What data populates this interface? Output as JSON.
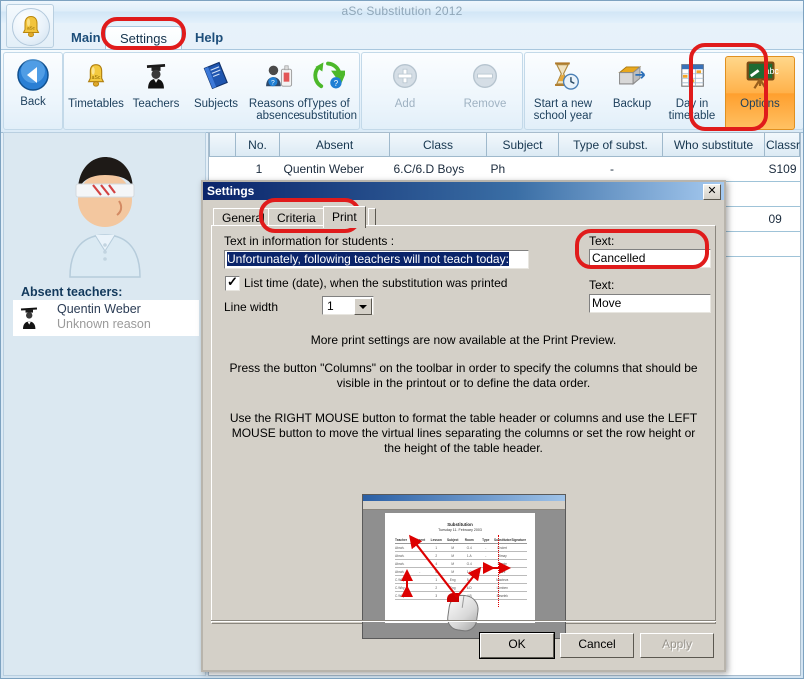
{
  "window": {
    "title": "aSc Substitution 2012",
    "logo_icon": "bell-icon"
  },
  "menu": {
    "items": [
      {
        "label": "Main",
        "active": false
      },
      {
        "label": "Settings",
        "active": true
      },
      {
        "label": "Help",
        "active": false
      }
    ]
  },
  "ribbon": {
    "nav": {
      "label": "Back",
      "icon": "back-arrow-icon"
    },
    "group1": [
      {
        "label": "Timetables",
        "icon": "bell-icon"
      },
      {
        "label": "Teachers",
        "icon": "teacher-icon"
      },
      {
        "label": "Subjects",
        "icon": "book-icon"
      },
      {
        "label": "Reasons of absence",
        "icon": "reasons-icon"
      },
      {
        "label": "Types of substitution",
        "icon": "recycle-icon"
      }
    ],
    "group2": [
      {
        "label": "Add",
        "icon": "plus-icon",
        "disabled": true
      },
      {
        "label": "Remove",
        "icon": "minus-icon",
        "disabled": true
      }
    ],
    "group3": [
      {
        "label": "Start a new school year",
        "icon": "hourglass-icon"
      },
      {
        "label": "Backup",
        "icon": "backup-icon"
      },
      {
        "label": "Day in timetable",
        "icon": "calendar-icon"
      },
      {
        "label": "Options",
        "icon": "blackboard-icon",
        "highlighted": true
      }
    ]
  },
  "sidebar": {
    "avatar_icon": "injured-teacher-avatar",
    "absent_title": "Absent teachers:",
    "absent_list": [
      {
        "icon": "graduate-icon",
        "name": "Quentin Weber",
        "reason": "Unknown reason"
      }
    ]
  },
  "grid": {
    "columns": [
      "",
      "No.",
      "Absent",
      "Class",
      "Subject",
      "Type of subst.",
      "Who substitute",
      "Classroom"
    ],
    "rows": [
      {
        "sel": "",
        "no": "1",
        "absent": "Quentin Weber",
        "class": "6.C/6.D Boys",
        "subject": "Ph",
        "type": "-",
        "who": "",
        "classroom": "S109"
      },
      {
        "sel": "",
        "no": "",
        "absent": "",
        "class": "",
        "subject": "",
        "type": "",
        "who": "",
        "classroom": ""
      },
      {
        "sel": "",
        "no": "",
        "absent": "",
        "class": "",
        "subject": "",
        "type": "",
        "who": "",
        "classroom": "09"
      },
      {
        "sel": "",
        "no": "",
        "absent": "",
        "class": "",
        "subject": "",
        "type": "",
        "who": "",
        "classroom": ""
      }
    ]
  },
  "dialog": {
    "title": "Settings",
    "close_label": "✕",
    "tabs": [
      {
        "label": "General",
        "active": false
      },
      {
        "label": "Criteria",
        "active": false
      },
      {
        "label": "Print",
        "active": true
      }
    ],
    "info_label": "Text in information for students :",
    "info_value": "Unfortunately, following teachers will not teach today:",
    "checkbox_label": "List time (date), when the substitution was printed",
    "checkbox_checked": true,
    "line_width_label": "Line width",
    "line_width_value": "1",
    "text1_label": "Text:",
    "text1_value": "Cancelled",
    "text2_label": "Text:",
    "text2_value": "Move",
    "paragraph1": "More print settings are now available at the Print Preview.",
    "paragraph2": "Press the button \"Columns\" on the toolbar in order to specify the columns that should be visible in the printout or to define the data order.",
    "paragraph3": "Use the RIGHT MOUSE button to format the table header or columns and use the LEFT MOUSE button to move the virtual lines separating the columns or set the row height or the height of the table header.",
    "preview": {
      "heading": "Substitution",
      "subheading": "Tuesday 11. February 2003",
      "columns": [
        "Teacher",
        "Absent",
        "Lesson",
        "Subject",
        "Room",
        "Type",
        "Substitutor",
        "Signature"
      ],
      "rows": [
        [
          "Abrah.",
          "",
          "1",
          "M",
          "G.4",
          "-",
          "Endert",
          ""
        ],
        [
          "Abrah.",
          "",
          "2",
          "M",
          "1.A",
          "-",
          "Himay",
          ""
        ],
        [
          "Abrah.",
          "",
          "4",
          "M",
          "G.4",
          "-",
          "Burnie",
          ""
        ],
        [
          "Abrah.",
          "-",
          "6",
          "M",
          "1.C",
          "-",
          "Jure",
          ""
        ],
        [
          "C.Why",
          "",
          "1",
          "Eng",
          "5.A",
          "",
          "Macteva",
          ""
        ],
        [
          "C.Why",
          "",
          "2",
          "Eng",
          "6.D",
          "",
          "Lkmben",
          ""
        ],
        [
          "C.Why",
          "",
          "3",
          "Eng",
          "4.B",
          "",
          "Beselek",
          ""
        ]
      ]
    },
    "buttons": [
      {
        "label": "OK",
        "default": true,
        "disabled": false
      },
      {
        "label": "Cancel",
        "default": false,
        "disabled": false
      },
      {
        "label": "Apply",
        "default": false,
        "disabled": true
      }
    ]
  },
  "annotations": {
    "color": "#e01b1b",
    "targets": [
      "settings-menu-tab",
      "options-ribbon-button",
      "print-dialog-tab",
      "cancelled-text-field"
    ]
  }
}
